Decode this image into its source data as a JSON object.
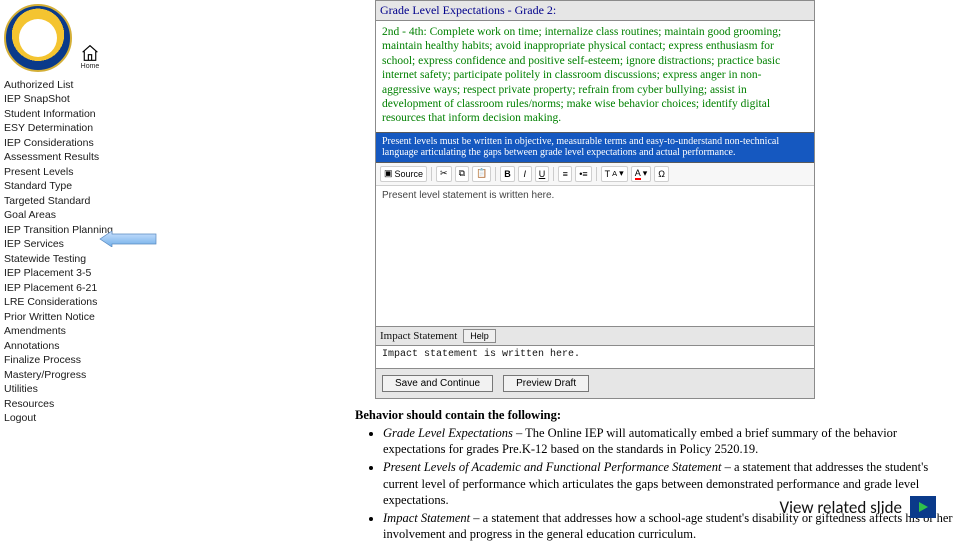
{
  "home": {
    "label": "Home"
  },
  "nav": [
    "Authorized List",
    "IEP SnapShot",
    "Student Information",
    "ESY Determination",
    "IEP Considerations",
    "Assessment Results",
    "Present Levels",
    "Standard Type",
    "Targeted Standard",
    "Goal Areas",
    "IEP Transition Planning",
    "IEP Services",
    "Statewide Testing",
    "IEP Placement 3-5",
    "IEP Placement 6-21",
    "LRE Considerations",
    "Prior Written Notice",
    "Amendments",
    "Annotations",
    "Finalize Process",
    "Mastery/Progress",
    "Utilities",
    "Resources",
    "Logout"
  ],
  "panel": {
    "gle_header": "Grade Level Expectations - Grade 2:",
    "gle_text": "2nd - 4th: Complete work on time; internalize class routines; maintain good grooming; maintain healthy habits; avoid inappropriate physical contact; express enthusiasm for school; express confidence and positive self-esteem; ignore distractions; practice basic internet safety; participate politely in classroom discussions; express anger in non-aggressive ways; respect private property; refrain from cyber bullying; assist in development of classroom rules/norms; make wise behavior choices; identify digital resources that inform decision making.",
    "blue_bar": "Present levels must be written in objective, measurable terms and easy-to-understand non-technical language articulating the gaps between grade level expectations and actual performance.",
    "editor_placeholder": "Present level statement is written here.",
    "impact_label": "Impact Statement",
    "help_label": "Help",
    "impact_text": "Impact statement is written here.",
    "save_btn": "Save and Continue",
    "preview_btn": "Preview Draft",
    "source_btn": "Source"
  },
  "body": {
    "lead": "Behavior should contain the following:",
    "b1_term": "Grade Level Expectations",
    "b1_rest": " – The Online IEP will automatically embed a brief summary of the behavior expectations for grades Pre.K-12 based on the standards in Policy 2520.19.",
    "b2_term": "Present Levels of Academic and Functional Performance Statement",
    "b2_rest": " – a statement that addresses the student's current level of performance which articulates the gaps between demonstrated performance and grade level expectations.",
    "b3_term": "Impact Statement",
    "b3_rest": " – a statement that addresses how a school-age student's disability or giftedness affects his or her involvement and progress in the general education curriculum."
  },
  "footer": {
    "link": "View related slide"
  }
}
